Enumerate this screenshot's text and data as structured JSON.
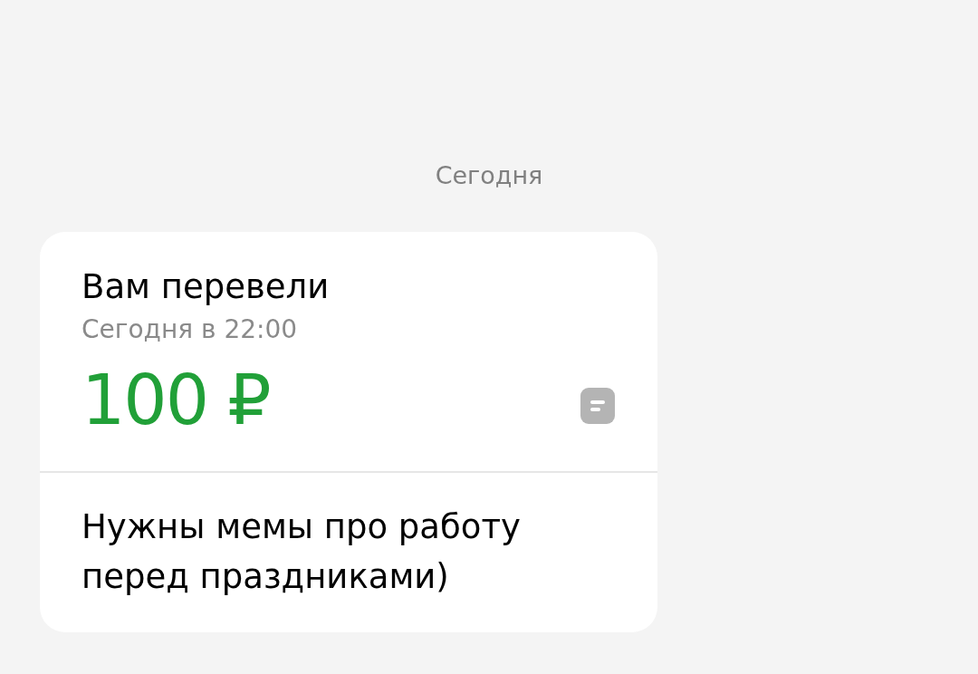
{
  "date_header": "Сегодня",
  "transfer": {
    "title": "Вам перевели",
    "time": "Сегодня в 22:00",
    "amount": "100 ₽",
    "has_message": true,
    "message": "Нужны мемы про работу перед праздниками)"
  }
}
